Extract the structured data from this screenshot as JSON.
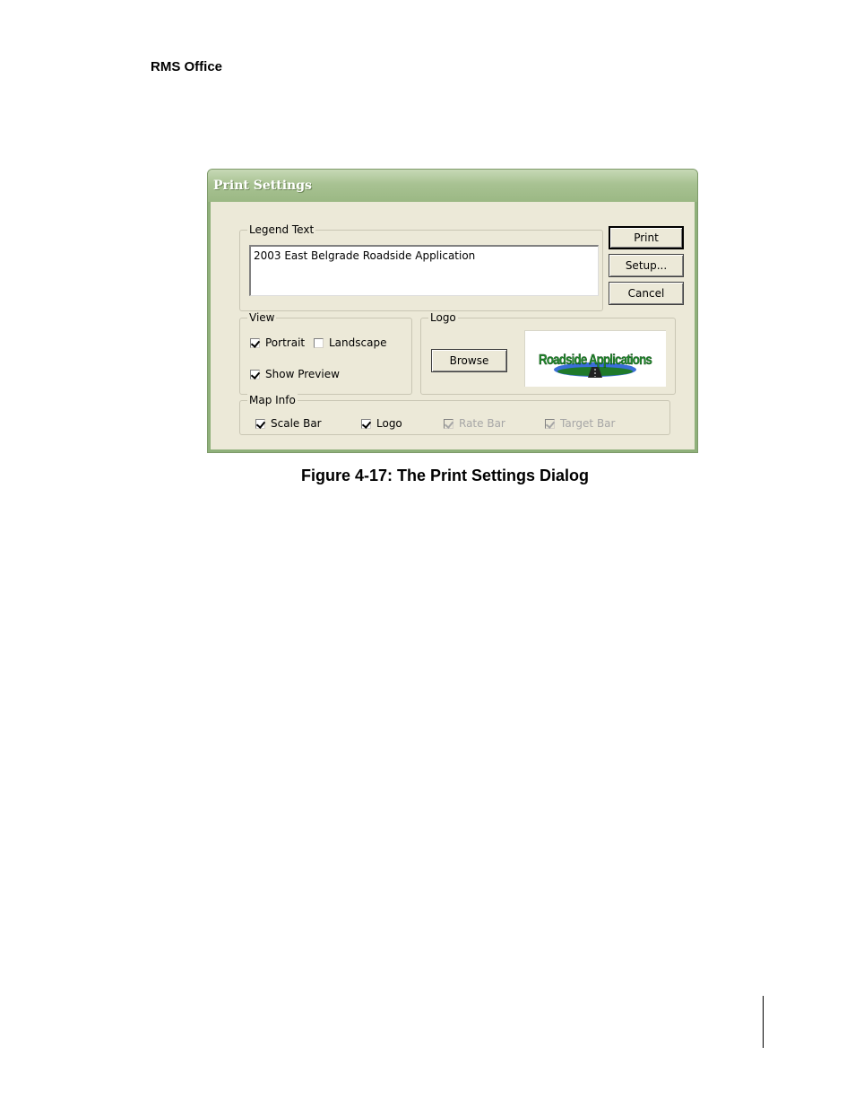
{
  "page": {
    "running_header": "RMS Office",
    "caption": "Figure 4-17: The Print Settings Dialog"
  },
  "dialog": {
    "title": "Print Settings",
    "legend_group_label": "Legend Text",
    "legend_text_value": "2003 East Belgrade Roadside Application",
    "buttons": {
      "print": "Print",
      "setup": "Setup...",
      "cancel": "Cancel",
      "browse": "Browse"
    },
    "view": {
      "label": "View",
      "portrait": {
        "label": "Portrait",
        "checked": true
      },
      "landscape": {
        "label": "Landscape",
        "checked": false
      },
      "show_preview": {
        "label": "Show Preview",
        "checked": true
      }
    },
    "logo": {
      "label": "Logo",
      "image_text": "Roadside Applications"
    },
    "map_info": {
      "label": "Map Info",
      "scale_bar": {
        "label": "Scale Bar",
        "checked": true,
        "enabled": true
      },
      "logo": {
        "label": "Logo",
        "checked": true,
        "enabled": true
      },
      "rate_bar": {
        "label": "Rate Bar",
        "checked": true,
        "enabled": false
      },
      "target_bar": {
        "label": "Target Bar",
        "checked": true,
        "enabled": false
      }
    }
  },
  "colors": {
    "titlebar": "#a8c292",
    "dialog_face": "#ece9d8",
    "logo_text_green": "#1f8a2a",
    "logo_sky_blue": "#3a6fd8"
  }
}
